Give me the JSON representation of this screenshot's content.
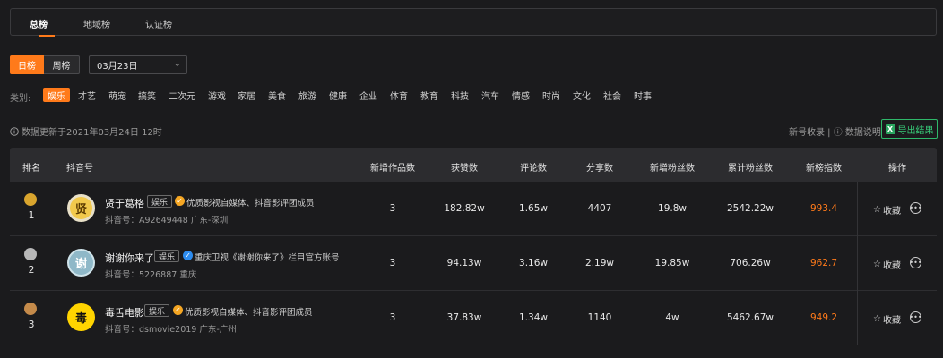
{
  "tabs": [
    {
      "label": "总榜"
    },
    {
      "label": "地域榜"
    },
    {
      "label": "认证榜"
    }
  ],
  "period": {
    "day": "日榜",
    "week": "周榜",
    "date": "03月23日"
  },
  "categories": {
    "label": "类别:",
    "items": [
      "娱乐",
      "才艺",
      "萌宠",
      "搞笑",
      "二次元",
      "游戏",
      "家居",
      "美食",
      "旅游",
      "健康",
      "企业",
      "体育",
      "教育",
      "科技",
      "汽车",
      "情感",
      "时尚",
      "文化",
      "社会",
      "时事"
    ]
  },
  "info": {
    "updated": "数据更新于2021年03月24日 12时",
    "collect": "新号收录",
    "sep": " | ",
    "explain": "数据说明",
    "export": "导出结果"
  },
  "table": {
    "headers": [
      "排名",
      "抖音号",
      "新增作品数",
      "获赞数",
      "评论数",
      "分享数",
      "新增粉丝数",
      "累计粉丝数",
      "新榜指数",
      "操作"
    ],
    "rows": [
      {
        "rank": "1",
        "name": "贤于葛格",
        "tag": "娱乐",
        "verify": "优质影视自媒体、抖音影评团成员",
        "id": "抖音号：A92649448 广东-深圳",
        "works": "3",
        "likes": "182.82w",
        "comments": "1.65w",
        "shares": "4407",
        "new_fans": "19.8w",
        "total_fans": "2542.22w",
        "index": "993.4",
        "fav": "收藏",
        "avatar_text": "贤"
      },
      {
        "rank": "2",
        "name": "谢谢你来了",
        "tag": "娱乐",
        "verify": "重庆卫视《谢谢你来了》栏目官方账号",
        "id": "抖音号：5226887 重庆",
        "works": "3",
        "likes": "94.13w",
        "comments": "3.16w",
        "shares": "2.19w",
        "new_fans": "19.85w",
        "total_fans": "706.26w",
        "index": "962.7",
        "fav": "收藏",
        "avatar_text": "谢"
      },
      {
        "rank": "3",
        "name": "毒舌电影",
        "tag": "娱乐",
        "verify": "优质影视自媒体、抖音影评团成员",
        "id": "抖音号：dsmovie2019 广东-广州",
        "works": "3",
        "likes": "37.83w",
        "comments": "1.34w",
        "shares": "1140",
        "new_fans": "4w",
        "total_fans": "5462.67w",
        "index": "949.2",
        "fav": "收藏",
        "avatar_text": "毒"
      }
    ]
  },
  "colors": {
    "accent": "#ff7a1a",
    "export_green": "#37c776",
    "verify_gold": "#f5a623",
    "verify_blue": "#2d8cf0"
  },
  "icons": [
    "chevron-down-icon",
    "info-icon",
    "help-icon",
    "excel-icon",
    "medal-icon",
    "verified-icon",
    "star-icon",
    "more-icon"
  ]
}
